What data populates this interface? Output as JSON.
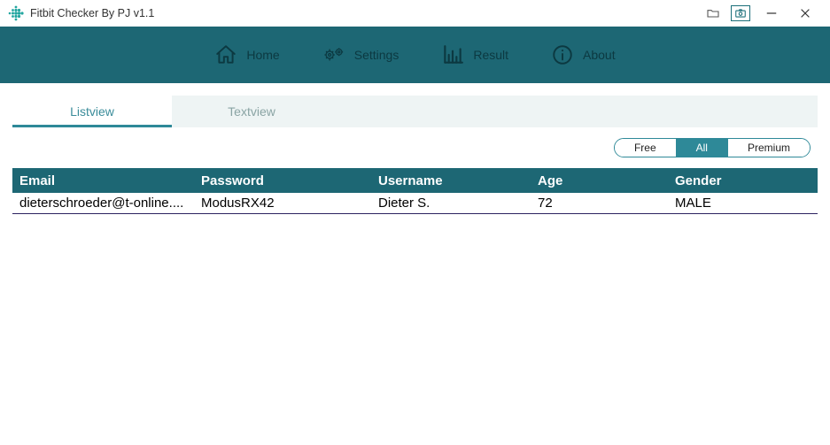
{
  "title": "Fitbit Checker By PJ v1.1",
  "nav": {
    "home": "Home",
    "settings": "Settings",
    "result": "Result",
    "about": "About"
  },
  "tabs": {
    "listview": "Listview",
    "textview": "Textview"
  },
  "filters": {
    "free": "Free",
    "all": "All",
    "premium": "Premium",
    "active": "All"
  },
  "table": {
    "headers": {
      "email": "Email",
      "password": "Password",
      "username": "Username",
      "age": "Age",
      "gender": "Gender"
    },
    "rows": [
      {
        "email": "dieterschroeder@t-online....",
        "password": "ModusRX42",
        "username": "Dieter S.",
        "age": "72",
        "gender": "MALE"
      }
    ]
  },
  "colors": {
    "primary": "#1d6774",
    "accent": "#2e8998"
  }
}
